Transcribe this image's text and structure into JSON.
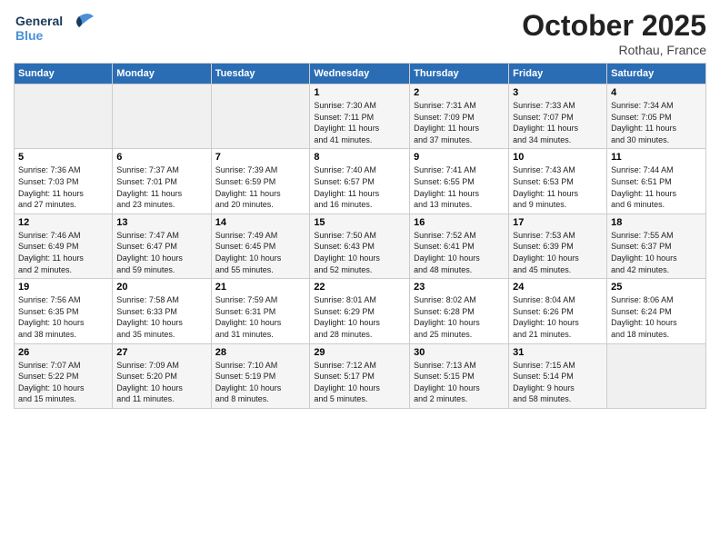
{
  "header": {
    "logo_line1": "General",
    "logo_line2": "Blue",
    "month": "October 2025",
    "location": "Rothau, France"
  },
  "weekdays": [
    "Sunday",
    "Monday",
    "Tuesday",
    "Wednesday",
    "Thursday",
    "Friday",
    "Saturday"
  ],
  "weeks": [
    [
      {
        "day": "",
        "info": ""
      },
      {
        "day": "",
        "info": ""
      },
      {
        "day": "",
        "info": ""
      },
      {
        "day": "1",
        "info": "Sunrise: 7:30 AM\nSunset: 7:11 PM\nDaylight: 11 hours\nand 41 minutes."
      },
      {
        "day": "2",
        "info": "Sunrise: 7:31 AM\nSunset: 7:09 PM\nDaylight: 11 hours\nand 37 minutes."
      },
      {
        "day": "3",
        "info": "Sunrise: 7:33 AM\nSunset: 7:07 PM\nDaylight: 11 hours\nand 34 minutes."
      },
      {
        "day": "4",
        "info": "Sunrise: 7:34 AM\nSunset: 7:05 PM\nDaylight: 11 hours\nand 30 minutes."
      }
    ],
    [
      {
        "day": "5",
        "info": "Sunrise: 7:36 AM\nSunset: 7:03 PM\nDaylight: 11 hours\nand 27 minutes."
      },
      {
        "day": "6",
        "info": "Sunrise: 7:37 AM\nSunset: 7:01 PM\nDaylight: 11 hours\nand 23 minutes."
      },
      {
        "day": "7",
        "info": "Sunrise: 7:39 AM\nSunset: 6:59 PM\nDaylight: 11 hours\nand 20 minutes."
      },
      {
        "day": "8",
        "info": "Sunrise: 7:40 AM\nSunset: 6:57 PM\nDaylight: 11 hours\nand 16 minutes."
      },
      {
        "day": "9",
        "info": "Sunrise: 7:41 AM\nSunset: 6:55 PM\nDaylight: 11 hours\nand 13 minutes."
      },
      {
        "day": "10",
        "info": "Sunrise: 7:43 AM\nSunset: 6:53 PM\nDaylight: 11 hours\nand 9 minutes."
      },
      {
        "day": "11",
        "info": "Sunrise: 7:44 AM\nSunset: 6:51 PM\nDaylight: 11 hours\nand 6 minutes."
      }
    ],
    [
      {
        "day": "12",
        "info": "Sunrise: 7:46 AM\nSunset: 6:49 PM\nDaylight: 11 hours\nand 2 minutes."
      },
      {
        "day": "13",
        "info": "Sunrise: 7:47 AM\nSunset: 6:47 PM\nDaylight: 10 hours\nand 59 minutes."
      },
      {
        "day": "14",
        "info": "Sunrise: 7:49 AM\nSunset: 6:45 PM\nDaylight: 10 hours\nand 55 minutes."
      },
      {
        "day": "15",
        "info": "Sunrise: 7:50 AM\nSunset: 6:43 PM\nDaylight: 10 hours\nand 52 minutes."
      },
      {
        "day": "16",
        "info": "Sunrise: 7:52 AM\nSunset: 6:41 PM\nDaylight: 10 hours\nand 48 minutes."
      },
      {
        "day": "17",
        "info": "Sunrise: 7:53 AM\nSunset: 6:39 PM\nDaylight: 10 hours\nand 45 minutes."
      },
      {
        "day": "18",
        "info": "Sunrise: 7:55 AM\nSunset: 6:37 PM\nDaylight: 10 hours\nand 42 minutes."
      }
    ],
    [
      {
        "day": "19",
        "info": "Sunrise: 7:56 AM\nSunset: 6:35 PM\nDaylight: 10 hours\nand 38 minutes."
      },
      {
        "day": "20",
        "info": "Sunrise: 7:58 AM\nSunset: 6:33 PM\nDaylight: 10 hours\nand 35 minutes."
      },
      {
        "day": "21",
        "info": "Sunrise: 7:59 AM\nSunset: 6:31 PM\nDaylight: 10 hours\nand 31 minutes."
      },
      {
        "day": "22",
        "info": "Sunrise: 8:01 AM\nSunset: 6:29 PM\nDaylight: 10 hours\nand 28 minutes."
      },
      {
        "day": "23",
        "info": "Sunrise: 8:02 AM\nSunset: 6:28 PM\nDaylight: 10 hours\nand 25 minutes."
      },
      {
        "day": "24",
        "info": "Sunrise: 8:04 AM\nSunset: 6:26 PM\nDaylight: 10 hours\nand 21 minutes."
      },
      {
        "day": "25",
        "info": "Sunrise: 8:06 AM\nSunset: 6:24 PM\nDaylight: 10 hours\nand 18 minutes."
      }
    ],
    [
      {
        "day": "26",
        "info": "Sunrise: 7:07 AM\nSunset: 5:22 PM\nDaylight: 10 hours\nand 15 minutes."
      },
      {
        "day": "27",
        "info": "Sunrise: 7:09 AM\nSunset: 5:20 PM\nDaylight: 10 hours\nand 11 minutes."
      },
      {
        "day": "28",
        "info": "Sunrise: 7:10 AM\nSunset: 5:19 PM\nDaylight: 10 hours\nand 8 minutes."
      },
      {
        "day": "29",
        "info": "Sunrise: 7:12 AM\nSunset: 5:17 PM\nDaylight: 10 hours\nand 5 minutes."
      },
      {
        "day": "30",
        "info": "Sunrise: 7:13 AM\nSunset: 5:15 PM\nDaylight: 10 hours\nand 2 minutes."
      },
      {
        "day": "31",
        "info": "Sunrise: 7:15 AM\nSunset: 5:14 PM\nDaylight: 9 hours\nand 58 minutes."
      },
      {
        "day": "",
        "info": ""
      }
    ]
  ]
}
